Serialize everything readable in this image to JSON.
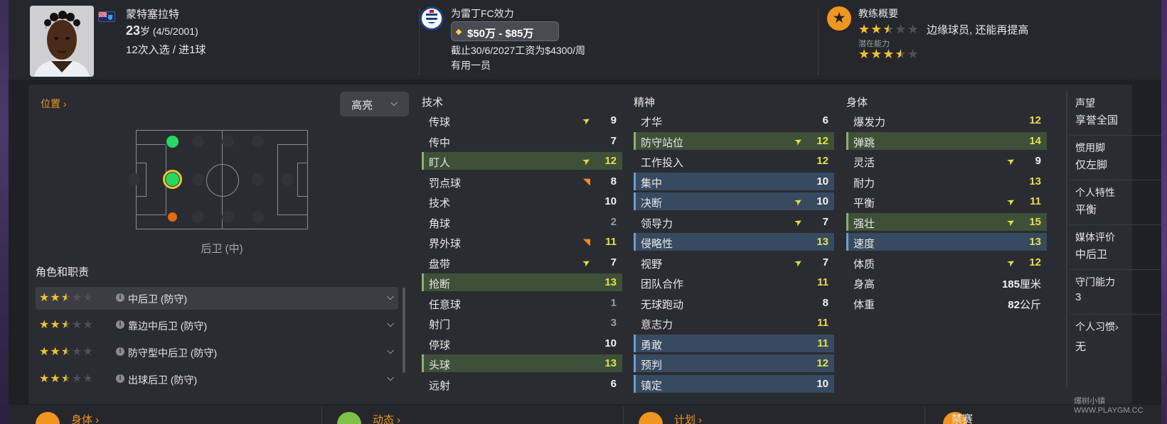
{
  "player": {
    "name": "蒙特塞拉特",
    "age": "23",
    "age_unit": "岁",
    "dob": "(4/5/2001)",
    "caps": "12次入选 / 进1球"
  },
  "club": {
    "title": "为雷丁FC效力",
    "value": "$50万 - $85万",
    "contract": "截止30/6/2027工资为$4300/周",
    "status": "有用一员"
  },
  "coach": {
    "title": "教练概要",
    "current_stars": 2.5,
    "description": "边缘球员, 还能再提高",
    "potential_label": "潜在能力",
    "potential_stars": 3.5
  },
  "position": {
    "link": "位置",
    "highlight_button": "高亮",
    "position_name": "后卫 (中)"
  },
  "roles": {
    "title": "角色和职责",
    "items": [
      {
        "name": "中后卫 (防守)",
        "stars": 2.5
      },
      {
        "name": "靠边中后卫 (防守)",
        "stars": 2.5
      },
      {
        "name": "防守型中后卫 (防守)",
        "stars": 2.5
      },
      {
        "name": "出球后卫 (防守)",
        "stars": 2.5
      }
    ]
  },
  "attributes": {
    "technical_title": "技术",
    "mental_title": "精神",
    "physical_title": "身体",
    "technical": [
      {
        "name": "传球",
        "value": "9",
        "arrow": "up",
        "style": ""
      },
      {
        "name": "传中",
        "value": "7",
        "arrow": "",
        "style": ""
      },
      {
        "name": "盯人",
        "value": "12",
        "arrow": "up",
        "style": "k"
      },
      {
        "name": "罚点球",
        "value": "8",
        "arrow": "down",
        "style": ""
      },
      {
        "name": "技术",
        "value": "10",
        "arrow": "",
        "style": ""
      },
      {
        "name": "角球",
        "value": "2",
        "arrow": "",
        "style": ""
      },
      {
        "name": "界外球",
        "value": "11",
        "arrow": "down",
        "style": ""
      },
      {
        "name": "盘带",
        "value": "7",
        "arrow": "up",
        "style": ""
      },
      {
        "name": "抢断",
        "value": "13",
        "arrow": "",
        "style": "k"
      },
      {
        "name": "任意球",
        "value": "1",
        "arrow": "",
        "style": ""
      },
      {
        "name": "射门",
        "value": "3",
        "arrow": "",
        "style": ""
      },
      {
        "name": "停球",
        "value": "10",
        "arrow": "",
        "style": ""
      },
      {
        "name": "头球",
        "value": "13",
        "arrow": "",
        "style": "k"
      },
      {
        "name": "远射",
        "value": "6",
        "arrow": "",
        "style": ""
      }
    ],
    "mental": [
      {
        "name": "才华",
        "value": "6",
        "arrow": "",
        "style": ""
      },
      {
        "name": "防守站位",
        "value": "12",
        "arrow": "up",
        "style": "k"
      },
      {
        "name": "工作投入",
        "value": "12",
        "arrow": "",
        "style": ""
      },
      {
        "name": "集中",
        "value": "10",
        "arrow": "",
        "style": "b"
      },
      {
        "name": "决断",
        "value": "10",
        "arrow": "up",
        "style": "b"
      },
      {
        "name": "领导力",
        "value": "7",
        "arrow": "up",
        "style": ""
      },
      {
        "name": "侵略性",
        "value": "13",
        "arrow": "",
        "style": "b"
      },
      {
        "name": "视野",
        "value": "7",
        "arrow": "up",
        "style": ""
      },
      {
        "name": "团队合作",
        "value": "11",
        "arrow": "",
        "style": ""
      },
      {
        "name": "无球跑动",
        "value": "8",
        "arrow": "",
        "style": ""
      },
      {
        "name": "意志力",
        "value": "11",
        "arrow": "",
        "style": ""
      },
      {
        "name": "勇敢",
        "value": "11",
        "arrow": "",
        "style": "b"
      },
      {
        "name": "预判",
        "value": "12",
        "arrow": "",
        "style": "b"
      },
      {
        "name": "镇定",
        "value": "10",
        "arrow": "",
        "style": "b"
      }
    ],
    "physical": [
      {
        "name": "爆发力",
        "value": "12",
        "arrow": "",
        "style": ""
      },
      {
        "name": "弹跳",
        "value": "14",
        "arrow": "",
        "style": "k"
      },
      {
        "name": "灵活",
        "value": "9",
        "arrow": "up",
        "style": ""
      },
      {
        "name": "耐力",
        "value": "13",
        "arrow": "",
        "style": ""
      },
      {
        "name": "平衡",
        "value": "11",
        "arrow": "up",
        "style": ""
      },
      {
        "name": "强壮",
        "value": "15",
        "arrow": "up",
        "style": "k"
      },
      {
        "name": "速度",
        "value": "13",
        "arrow": "",
        "style": "b"
      },
      {
        "name": "体质",
        "value": "12",
        "arrow": "up",
        "style": ""
      },
      {
        "name": "身高",
        "value": "185",
        "unit": "厘米",
        "arrow": "",
        "style": ""
      },
      {
        "name": "体重",
        "value": "82",
        "unit": "公斤",
        "arrow": "",
        "style": ""
      }
    ]
  },
  "side": {
    "reputation_label": "声望",
    "reputation": "享誉全国",
    "foot_label": "惯用脚",
    "foot": "仅左脚",
    "trait_label": "个人特性",
    "trait": "平衡",
    "media_label": "媒体评价",
    "media": "中后卫",
    "gk_label": "守门能力",
    "gk": "3",
    "habits_label": "个人习惯",
    "habits": "无"
  },
  "bottom": {
    "physical": "身体",
    "dynamics": "动态",
    "plan": "计划",
    "suspension": "禁赛"
  },
  "watermark": "爆树小镇 WWW.PLAYGM.CC",
  "colors": {
    "accent": "#f0961e",
    "key_attr_bg": "#3e5038",
    "role_attr_bg": "#364b60",
    "high_value": "#e3e04a",
    "star": "#f2c12e"
  }
}
